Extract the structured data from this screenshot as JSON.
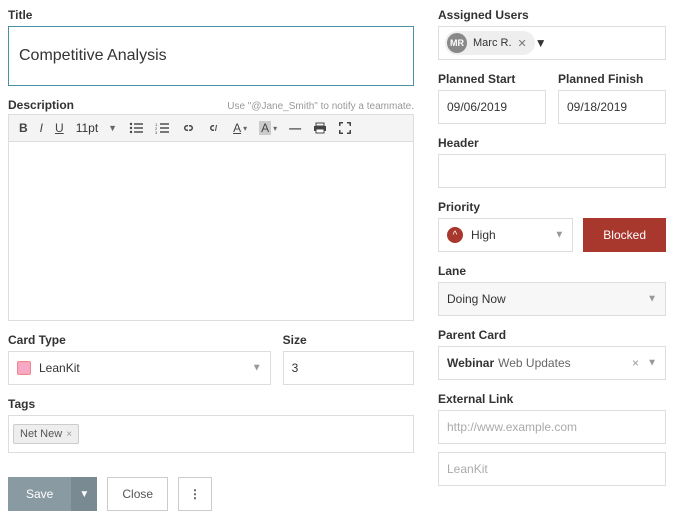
{
  "title": {
    "label": "Title",
    "value": "Competitive Analysis"
  },
  "description": {
    "label": "Description",
    "hint": "Use \"@Jane_Smith\" to notify a teammate.",
    "font_size": "11pt"
  },
  "card_type": {
    "label": "Card Type",
    "value": "LeanKit"
  },
  "size": {
    "label": "Size",
    "value": "3"
  },
  "tags": {
    "label": "Tags",
    "items": [
      "Net New"
    ]
  },
  "buttons": {
    "save": "Save",
    "close": "Close"
  },
  "assigned_users": {
    "label": "Assigned Users",
    "users": [
      {
        "initials": "MR",
        "name": "Marc R."
      }
    ]
  },
  "planned_start": {
    "label": "Planned Start",
    "value": "09/06/2019"
  },
  "planned_finish": {
    "label": "Planned Finish",
    "value": "09/18/2019"
  },
  "header_field": {
    "label": "Header",
    "value": ""
  },
  "priority": {
    "label": "Priority",
    "value": "High",
    "blocked": "Blocked"
  },
  "lane": {
    "label": "Lane",
    "value": "Doing Now"
  },
  "parent_card": {
    "label": "Parent Card",
    "bold": "Webinar",
    "rest": "Web Updates"
  },
  "external_link": {
    "label": "External Link",
    "url_placeholder": "http://www.example.com",
    "label_placeholder": "LeanKit"
  }
}
